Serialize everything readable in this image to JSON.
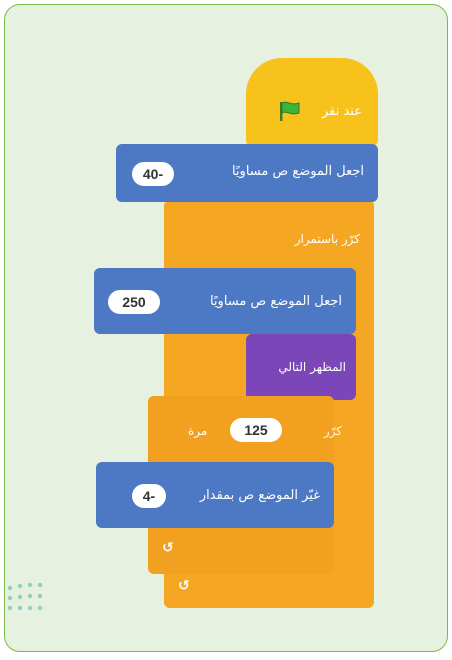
{
  "script": {
    "hat": {
      "label": "عند نقر",
      "icon": "green-flag-icon",
      "color": "#f6c21b"
    },
    "set_y_1": {
      "label": "اجعل الموضع ص مساويًا",
      "value": "40-"
    },
    "forever": {
      "label": "كرّر باستمرار"
    },
    "set_y_2": {
      "label": "اجعل الموضع ص مساويًا",
      "value": "250"
    },
    "show": {
      "label": "المظهر التالي"
    },
    "repeat": {
      "label_prefix": "كرّر",
      "value": "125",
      "label_suffix": "مرة"
    },
    "change_y": {
      "label": "غيّر الموضع ص بمقدار",
      "value": "4-"
    },
    "loop_end_icon": "↺"
  },
  "colors": {
    "events": "#f6c21b",
    "control": "#f5a623",
    "motion": "#4c78c4",
    "looks": "#7a46b8",
    "panel": "#e7f1df",
    "panel_border": "#7fb84d"
  }
}
